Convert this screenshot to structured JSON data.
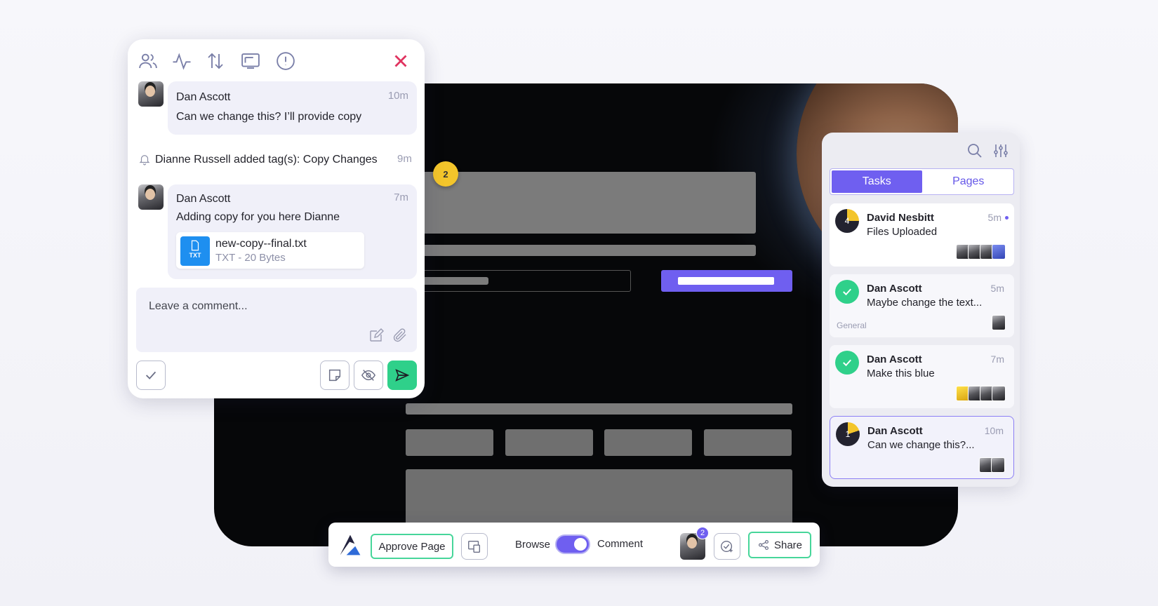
{
  "comment_panel": {
    "toolbar_icons": [
      "users-icon",
      "activity-icon",
      "sort-icon",
      "screen-icon",
      "info-icon"
    ],
    "messages": [
      {
        "author": "Dan Ascott",
        "time": "10m",
        "text": "Can we change this? I’ll provide copy"
      },
      {
        "author": "Dan Ascott",
        "time": "7m",
        "text": "Adding copy for you here Dianne",
        "attachment": {
          "name": "new-copy--final.txt",
          "meta": "TXT - 20 Bytes",
          "icon_label": "TXT"
        }
      }
    ],
    "activity": {
      "text": "Dianne Russell added tag(s): Copy Changes",
      "time": "9m"
    },
    "comment_placeholder": "Leave a comment..."
  },
  "pin": {
    "count": "2"
  },
  "tasks_panel": {
    "tabs": [
      {
        "label": "Tasks",
        "active": true
      },
      {
        "label": "Pages",
        "active": false
      }
    ],
    "tasks": [
      {
        "author": "David Nesbitt",
        "time": "5m",
        "text": "Files Uploaded",
        "status": "in-progress",
        "number": "4",
        "tag": "",
        "unread": true
      },
      {
        "author": "Dan Ascott",
        "time": "5m",
        "text": "Maybe change the text...",
        "status": "done",
        "number": "",
        "tag": "General",
        "unread": false
      },
      {
        "author": "Dan Ascott",
        "time": "7m",
        "text": "Make this blue",
        "status": "done",
        "number": "",
        "tag": "",
        "unread": false
      },
      {
        "author": "Dan Ascott",
        "time": "10m",
        "text": "Can we change this?...",
        "status": "in-progress",
        "number": "1",
        "tag": "",
        "unread": false,
        "selected": true
      }
    ]
  },
  "toolbar": {
    "approve_label": "Approve Page",
    "browse_label": "Browse",
    "comment_label": "Comment",
    "mode_is_comment": true,
    "notification_count": "2",
    "share_label": "Share"
  },
  "colors": {
    "accent": "#6f5ff0",
    "success": "#2fd08a",
    "warning": "#f3c52b",
    "danger": "#e0335f"
  }
}
